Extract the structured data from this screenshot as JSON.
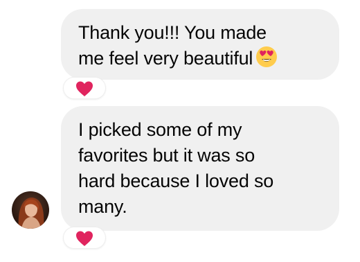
{
  "messages": [
    {
      "lines": [
        "Thank you!!! You made",
        "me feel very beautiful"
      ],
      "trailing_emoji": "heart-eyes-emoji",
      "reaction": "red-heart-icon"
    },
    {
      "lines": [
        "I picked some of my",
        "favorites but it was so",
        "hard because I loved so",
        "many."
      ],
      "reaction": "red-heart-icon",
      "sender_avatar": "avatar"
    }
  ],
  "colors": {
    "bubble_bg": "#f0f0f0",
    "text": "#050505",
    "heart": "#e0245e",
    "emoji_face": "#ffcc4d"
  }
}
